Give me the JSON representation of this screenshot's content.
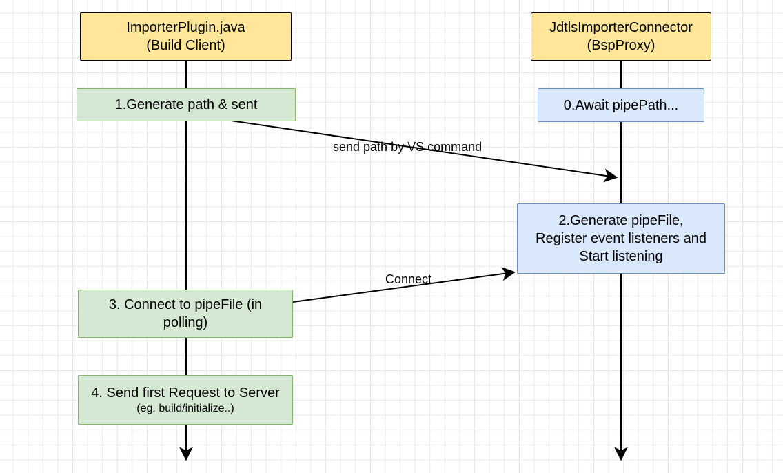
{
  "lifelines": {
    "left": {
      "title_line1": "ImporterPlugin.java",
      "title_line2": "(Build Client)"
    },
    "right": {
      "title_line1": "JdtlsImporterConnector",
      "title_line2": "(BspProxy)"
    }
  },
  "steps": {
    "s1": "1.Generate path & sent",
    "s0": "0.Await pipePath...",
    "s2_line1": "2.Generate pipeFile,",
    "s2_line2": "Register event listeners and",
    "s2_line3": "Start listening",
    "s3_line1": "3. Connect to pipeFile (in",
    "s3_line2": "polling)",
    "s4_line1": "4. Send first Request to Server",
    "s4_line2": "(eg. build/initialize..)"
  },
  "messages": {
    "m1": "send path by VS command",
    "m2": "Connect"
  }
}
